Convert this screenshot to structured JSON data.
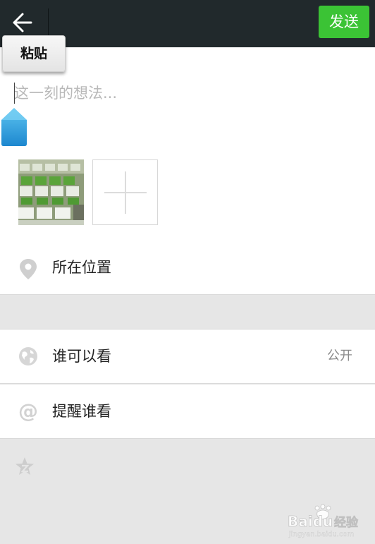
{
  "header": {
    "back_icon": "back-arrow-icon",
    "send_label": "发送",
    "accent_color": "#3bc335",
    "bar_color": "#21292c"
  },
  "composer": {
    "paste_label": "粘贴",
    "placeholder": "这一刻的想法...",
    "value": "",
    "photos": [
      {
        "icon": "photo-thumbnail"
      }
    ],
    "add_photo_icon": "plus-icon"
  },
  "options": [
    {
      "icon": "location-pin-icon",
      "label": "所在位置",
      "value": ""
    },
    {
      "icon": "globe-icon",
      "label": "谁可以看",
      "value": "公开"
    },
    {
      "icon": "at-sign-icon",
      "label": "提醒谁看",
      "value": ""
    }
  ],
  "footer": {
    "icon": "star-icon"
  },
  "watermark": {
    "brand": "Baidu",
    "sub": "经验",
    "url": "jingyan.baidu.com"
  }
}
